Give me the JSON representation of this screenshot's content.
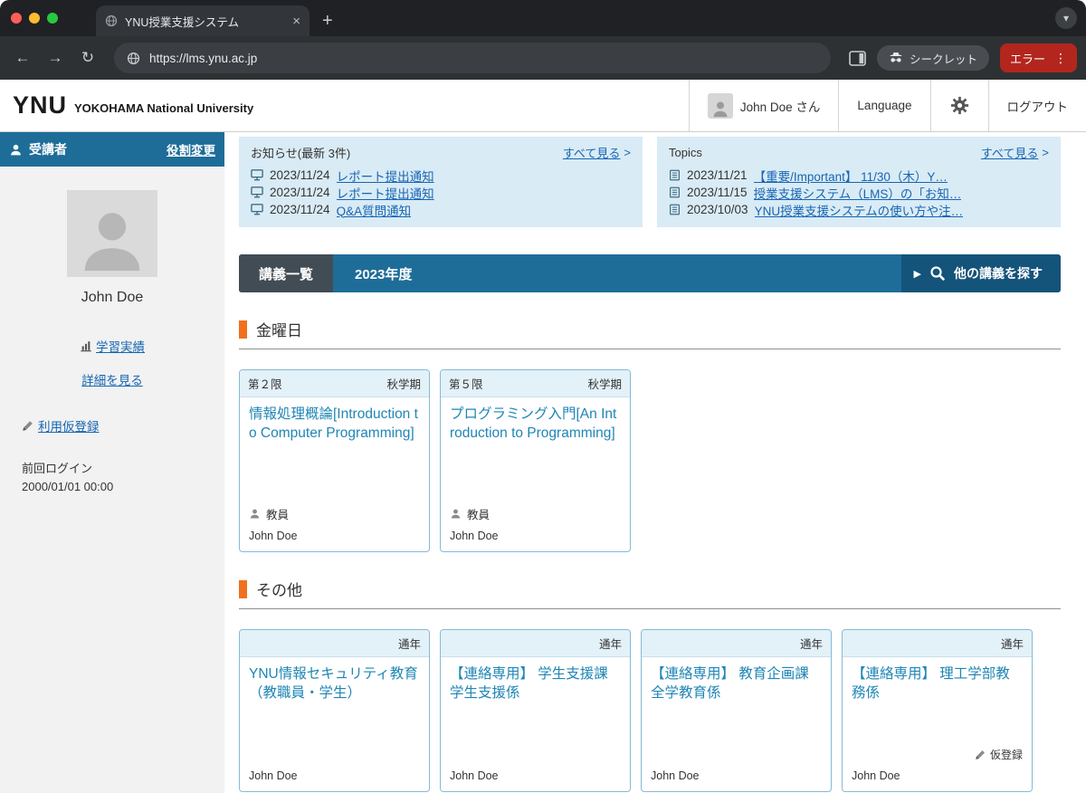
{
  "icons": {
    "back": "←",
    "forward": "→",
    "reload": "↻",
    "new_tab": "+",
    "close_tab": "×",
    "menu_dots": "⋮",
    "window_chevron": "▾",
    "play": "▶",
    "chevron": ">"
  },
  "browser": {
    "tab_title": "YNU授業支援システム",
    "url": "https://lms.ynu.ac.jp",
    "incognito_label": "シークレット",
    "error_label": "エラー"
  },
  "site_header": {
    "logo_ynu": "YNU",
    "logo_sub": "YOKOHAMA National University",
    "user_name": "John Doe さん",
    "language": "Language",
    "logout": "ログアウト"
  },
  "sidebar": {
    "role": "受講者",
    "role_change": "役割変更",
    "user_name": "John Doe",
    "learning_record": "学習実績",
    "see_details": "詳細を見る",
    "provisional_registration": "利用仮登録",
    "last_login_label": "前回ログイン",
    "last_login_value": "2000/01/01 00:00"
  },
  "notices": {
    "title": "お知らせ(最新 3件)",
    "see_all": "すべて見る",
    "items": [
      {
        "date": "2023/11/24",
        "label": "レポート提出通知"
      },
      {
        "date": "2023/11/24",
        "label": "レポート提出通知"
      },
      {
        "date": "2023/11/24",
        "label": "Q&A質問通知"
      }
    ]
  },
  "topics": {
    "title": "Topics",
    "see_all": "すべて見る",
    "items": [
      {
        "date": "2023/11/21",
        "label": "【重要/Important】 11/30（木）Y…"
      },
      {
        "date": "2023/11/15",
        "label": "授業支援システム（LMS）の「お知…"
      },
      {
        "date": "2023/10/03",
        "label": "YNU授業支援システムの使い方や注…"
      }
    ]
  },
  "course_bar": {
    "list_label": "講義一覧",
    "year": "2023年度",
    "search_label": "他の講義を探す"
  },
  "sections": [
    {
      "title": "金曜日",
      "cards": [
        {
          "period": "第２限",
          "term": "秋学期",
          "title": "情報処理概論[Introduction to Computer Programming]",
          "teacher_label": "教員",
          "teacher": "John Doe"
        },
        {
          "period": "第５限",
          "term": "秋学期",
          "title": "プログラミング入門[An Introduction to Programming]",
          "teacher_label": "教員",
          "teacher": "John Doe"
        }
      ]
    },
    {
      "title": "その他",
      "cards": [
        {
          "term": "通年",
          "title": "YNU情報セキュリティ教育（教職員・学生）",
          "teacher": "John Doe"
        },
        {
          "term": "通年",
          "title": "【連絡専用】 学生支援課学生支援係",
          "teacher": "John Doe"
        },
        {
          "term": "通年",
          "title": "【連絡専用】 教育企画課全学教育係",
          "teacher": "John Doe"
        },
        {
          "term": "通年",
          "title": "【連絡専用】 理工学部教務係",
          "badge": "仮登録",
          "teacher": "John Doe"
        }
      ]
    }
  ]
}
